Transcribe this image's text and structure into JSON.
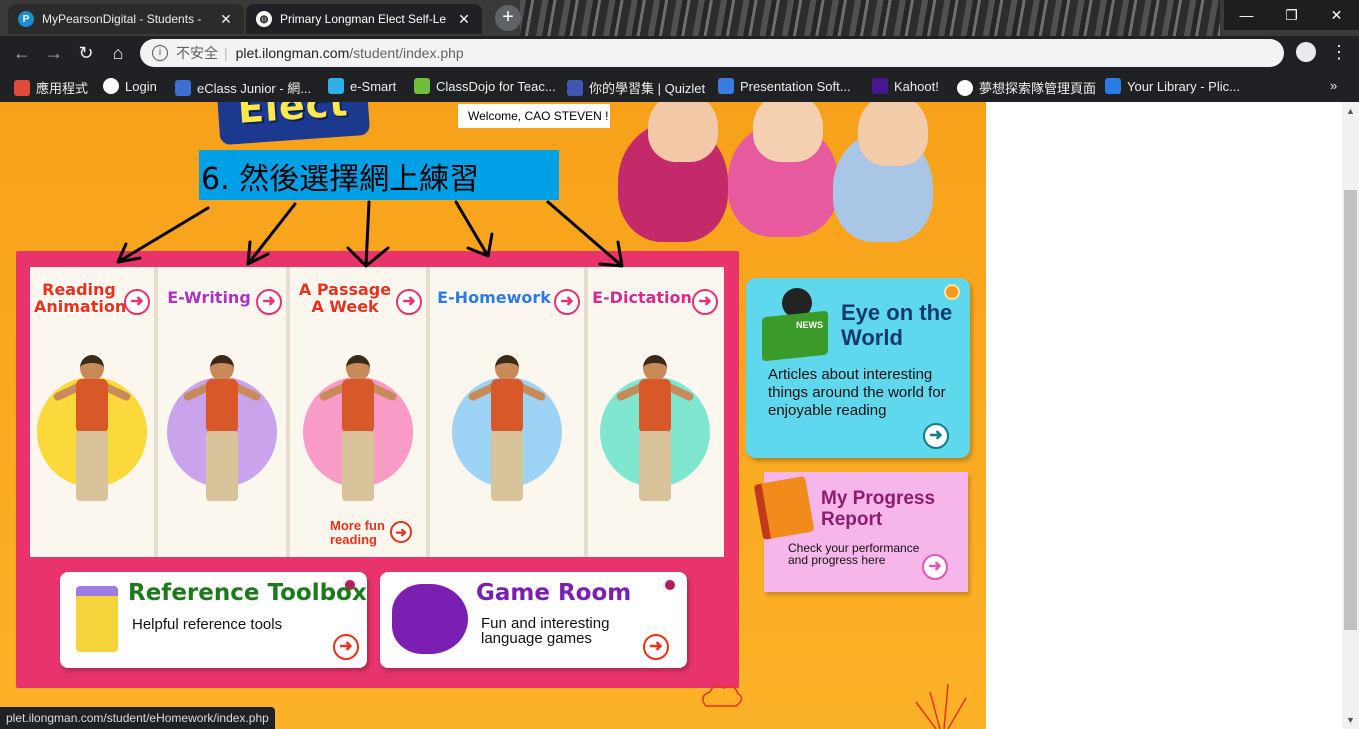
{
  "tabs": [
    {
      "title": "MyPearsonDigital - Students -",
      "favicon": "P"
    },
    {
      "title": "Primary Longman Elect Self-Le",
      "favicon": "globe"
    }
  ],
  "window": {
    "minimize": "—",
    "restore": "❐",
    "close": "✕"
  },
  "address": {
    "insecure_label": "不安全",
    "host": "plet.ilongman.com",
    "path": "/student/index.php"
  },
  "bookmarks": [
    {
      "label": "應用程式",
      "icon": "apps-icon",
      "color": "#e04b3a"
    },
    {
      "label": "Login",
      "icon": "globe-icon",
      "color": "#ffffff"
    },
    {
      "label": "eClass Junior - 網...",
      "icon": "eclass-icon",
      "color": "#3b6fd1"
    },
    {
      "label": "e-Smart",
      "icon": "esmart-icon",
      "color": "#2db0e8"
    },
    {
      "label": "ClassDojo for Teac...",
      "icon": "classdojo-icon",
      "color": "#6fbf3b"
    },
    {
      "label": "你的學習集 | Quizlet",
      "icon": "quizlet-icon",
      "color": "#4257b2"
    },
    {
      "label": "Presentation Soft...",
      "icon": "prezi-icon",
      "color": "#3a7be0"
    },
    {
      "label": "Kahoot!",
      "icon": "kahoot-icon",
      "color": "#46178f"
    },
    {
      "label": "夢想探索隊管理頁面",
      "icon": "globe-icon",
      "color": "#ffffff"
    },
    {
      "label": "Your Library - Plic...",
      "icon": "plickers-icon",
      "color": "#2a7be4"
    }
  ],
  "page": {
    "logo_text": "Elect",
    "welcome": "Welcome, CAO STEVEN !",
    "annotation": "6. 然後選擇網上練習",
    "activities": [
      {
        "label": "Reading Animation",
        "color": "#e8331a",
        "circle": "#fcd93a"
      },
      {
        "label": "E-Writing",
        "color": "#b02fc4",
        "circle": "#c9a4ec"
      },
      {
        "label": "A Passage A Week",
        "color": "#e8331a",
        "circle": "#f89bc6"
      },
      {
        "label": "E-Homework",
        "color": "#2f7ae0",
        "circle": "#9dd3f5"
      },
      {
        "label": "E-Dictation",
        "color": "#d82a8a",
        "circle": "#7fe6cf"
      }
    ],
    "more_fun": "More fun reading",
    "reference": {
      "title": "Reference Toolbox",
      "desc": "Helpful reference tools"
    },
    "game": {
      "title": "Game Room",
      "desc": "Fun and interesting language games"
    },
    "eye": {
      "title": "Eye on the World",
      "desc": "Articles about interesting things around the world for enjoyable reading",
      "badge": "NEWS"
    },
    "progress": {
      "title": "My Progress Report",
      "desc": "Check your performance and progress here"
    }
  },
  "status_url": "plet.ilongman.com/student/eHomework/index.php",
  "colors": {
    "accent": "#e8336c",
    "orange": "#f7a11a",
    "annotation_bg": "#00a0e6"
  }
}
